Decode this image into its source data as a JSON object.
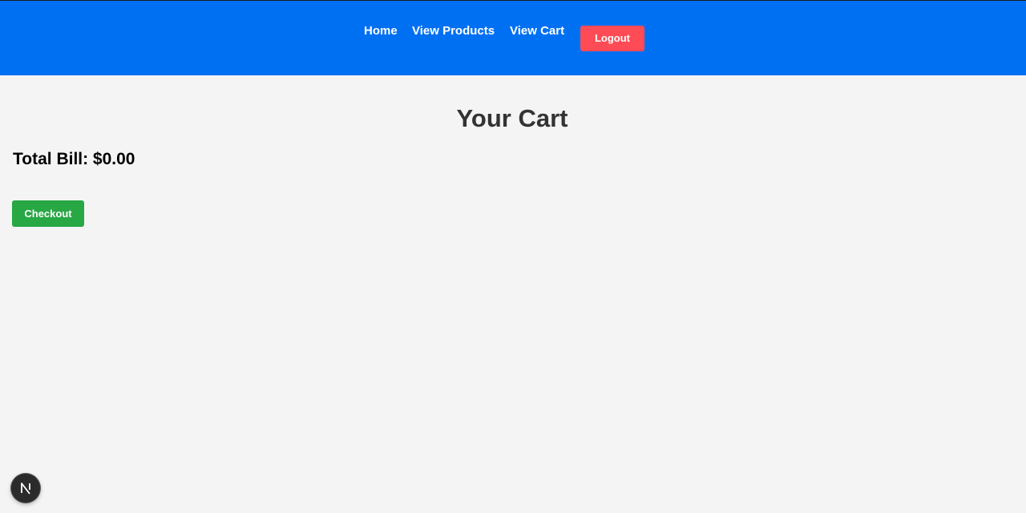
{
  "navbar": {
    "links": [
      {
        "label": "Home"
      },
      {
        "label": "View Products"
      },
      {
        "label": "View Cart"
      }
    ],
    "logout_label": "Logout",
    "background_color": "#0070f3",
    "logout_color": "#ff4b55"
  },
  "main": {
    "title": "Your Cart",
    "total_bill": "Total Bill: $0.00",
    "checkout_label": "Checkout",
    "checkout_color": "#28a745"
  },
  "dev_indicator": {
    "icon": "nextjs-logo-icon"
  }
}
